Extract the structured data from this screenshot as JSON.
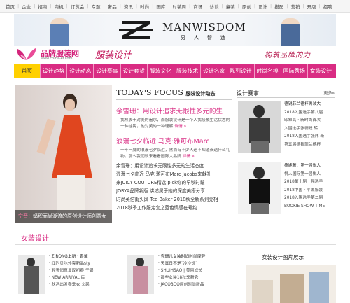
{
  "top_links": [
    "首页",
    "企业",
    "招商",
    "商机",
    "订货会",
    "专题",
    "奢品",
    "资讯",
    "时尚",
    "图库",
    "时装周",
    "商场",
    "访谈",
    "童装",
    "原创",
    "设计",
    "搭配",
    "营销",
    "开店",
    "招聘"
  ],
  "banner": {
    "brand": "MANWISDOM",
    "brand_cn": "男人智造"
  },
  "site": {
    "logo_title": "品牌服装网",
    "logo_url": "www.china-ef.com",
    "section": "服装设计",
    "slogan": "构筑品牌的力"
  },
  "main_nav": [
    "首页",
    "设计趋势",
    "设计动态",
    "设计赛事",
    "设计套货",
    "服装文化",
    "服装技术",
    "设计名家",
    "陈列设计",
    "时尚名模",
    "国际秀场",
    "女装设计"
  ],
  "feature": {
    "caption_red": "宁晋：",
    "caption": "蛹积而尚潮流的原创设计师创意女"
  },
  "focus": {
    "title": "TODAY'S FOCUS",
    "subtitle": "服装设计动态",
    "headline1": "余雪珊：用设计追求无限性多元的生",
    "desc1": "我热衷于对美的追求，而服装设计是一个人我接触生活状态的一种挂钩，他对美的一种理解",
    "headline2": "浪漫七夕临近 马克·雅可布Marc",
    "desc2": "一年一度的浪漫七夕临近，然而有不少人还不知道该送什么礼物，那么我们就来看看国际大品牌",
    "more": "详情 »",
    "news": [
      "余雪珊：用设计追求无限性多元的生活态度",
      "浪漫七夕临近 马克·雅可布Marc Jacobs来献礼",
      "来JUICY COUTURE精选 pick你的早秋时髦",
      "JORYA品牌新版 讲述属于她的深度美搭分享",
      "时尚英伦街头风 Ted Baker 2018秋全新系列亮相",
      "2018秋季工作服定套之蓝色情感在号约"
    ]
  },
  "right": {
    "title": "设计赛事",
    "more": "更多»",
    "box1": {
      "lead": "德锐菲兰德杯男装大",
      "items": [
        "2018入围选手第八届",
        "印象高 · 新时尚首次",
        "入围选手张德锐 转",
        "2018入围选手张炜 新",
        "第五届德锐菲兰德杯"
      ]
    },
    "box2": {
      "lead": "桑婉菁：第一届悦人",
      "items": [
        "悦人国际第一届悦人",
        "2018第十届一届选手",
        "2018中国 · 平湖服装",
        "2018入围选手第二届",
        "BOOKIE SHOW TIME"
      ]
    }
  },
  "section2": {
    "title": "女装设计",
    "list1": {
      "lead": "· ZIRONG上新 · 香馨",
      "items": [
        "· 红豹贝尔外套新品sty",
        "· 轻奢悄意复叹初春 子银",
        "· NEW ARRIVAL 民",
        "· 秋冯出发春季衣 文果"
      ]
    },
    "list2": {
      "lead": "· 秀珊儿女装时尚时尚摩登",
      "items": [
        "· 天真日不是“冷冷说”",
        "· SHUIHSAO | 美丽成长",
        "· 那些女装18秋季新秀",
        "· JACOBOO原创时尚新品"
      ]
    },
    "gallery_title": "女装设计图片展示"
  },
  "colors": {
    "brand_pink": "#d92c83",
    "home_yellow": "#ffd000"
  }
}
